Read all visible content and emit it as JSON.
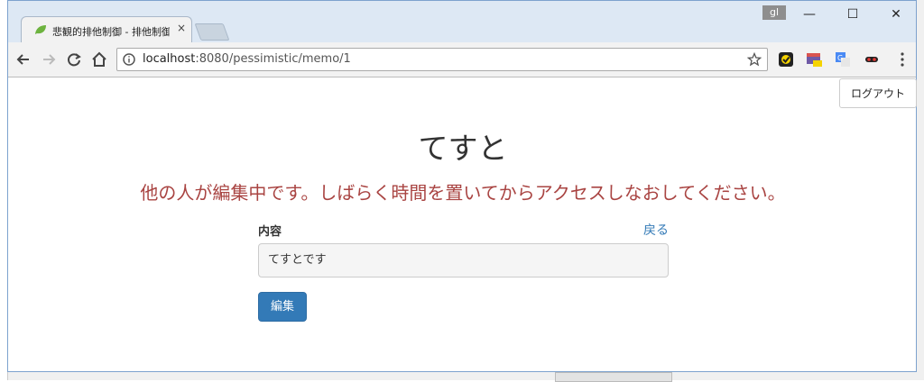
{
  "browser": {
    "tab_title": "悲観的排他制御 - 排他制御",
    "tab_close": "×",
    "profile_label": "gl",
    "url_host": "localhost",
    "url_rest": ":8080/pessimistic/memo/1",
    "window_controls": {
      "minimize": "—",
      "maximize": "☐",
      "close": "✕"
    },
    "icons": [
      "back-icon",
      "forward-icon",
      "reload-icon",
      "home-icon",
      "info-icon",
      "star-icon",
      "menu-icon"
    ]
  },
  "page": {
    "logout_label": "ログアウト",
    "memo_title": "てすと",
    "warning": "他の人が編集中です。しばらく時間を置いてからアクセスしなおしてください。",
    "content_label": "内容",
    "back_link": "戻る",
    "content_value": "てすとです",
    "edit_button": "編集"
  },
  "colors": {
    "warning": "#a94442",
    "primary": "#337ab7",
    "link": "#337ab7"
  }
}
